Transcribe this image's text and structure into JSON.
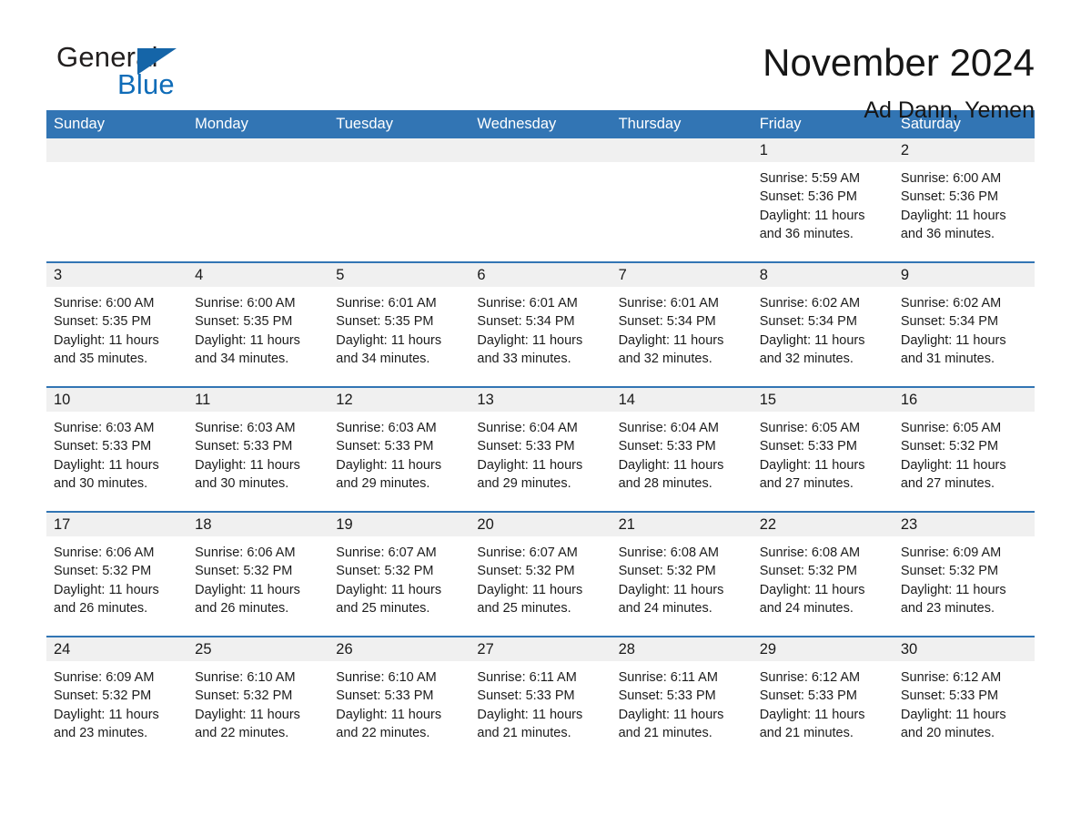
{
  "brand": {
    "word_one": "General",
    "word_two": "Blue",
    "triangle_color": "#1565a8",
    "blue_color": "#0f6cb8"
  },
  "header": {
    "title": "November 2024",
    "subtitle": "Ad Dann, Yemen"
  },
  "theme": {
    "header_bg": "#3275b4",
    "daynum_bg": "#f0f0f0",
    "rule_color": "#3275b4",
    "page_bg": "#ffffff",
    "text_color": "#1a1a1a"
  },
  "weekdays": [
    "Sunday",
    "Monday",
    "Tuesday",
    "Wednesday",
    "Thursday",
    "Friday",
    "Saturday"
  ],
  "weeks": [
    [
      {
        "empty": true
      },
      {
        "empty": true
      },
      {
        "empty": true
      },
      {
        "empty": true
      },
      {
        "empty": true
      },
      {
        "day": "1",
        "sunrise": "Sunrise: 5:59 AM",
        "sunset": "Sunset: 5:36 PM",
        "daylight_1": "Daylight: 11 hours",
        "daylight_2": "and 36 minutes."
      },
      {
        "day": "2",
        "sunrise": "Sunrise: 6:00 AM",
        "sunset": "Sunset: 5:36 PM",
        "daylight_1": "Daylight: 11 hours",
        "daylight_2": "and 36 minutes."
      }
    ],
    [
      {
        "day": "3",
        "sunrise": "Sunrise: 6:00 AM",
        "sunset": "Sunset: 5:35 PM",
        "daylight_1": "Daylight: 11 hours",
        "daylight_2": "and 35 minutes."
      },
      {
        "day": "4",
        "sunrise": "Sunrise: 6:00 AM",
        "sunset": "Sunset: 5:35 PM",
        "daylight_1": "Daylight: 11 hours",
        "daylight_2": "and 34 minutes."
      },
      {
        "day": "5",
        "sunrise": "Sunrise: 6:01 AM",
        "sunset": "Sunset: 5:35 PM",
        "daylight_1": "Daylight: 11 hours",
        "daylight_2": "and 34 minutes."
      },
      {
        "day": "6",
        "sunrise": "Sunrise: 6:01 AM",
        "sunset": "Sunset: 5:34 PM",
        "daylight_1": "Daylight: 11 hours",
        "daylight_2": "and 33 minutes."
      },
      {
        "day": "7",
        "sunrise": "Sunrise: 6:01 AM",
        "sunset": "Sunset: 5:34 PM",
        "daylight_1": "Daylight: 11 hours",
        "daylight_2": "and 32 minutes."
      },
      {
        "day": "8",
        "sunrise": "Sunrise: 6:02 AM",
        "sunset": "Sunset: 5:34 PM",
        "daylight_1": "Daylight: 11 hours",
        "daylight_2": "and 32 minutes."
      },
      {
        "day": "9",
        "sunrise": "Sunrise: 6:02 AM",
        "sunset": "Sunset: 5:34 PM",
        "daylight_1": "Daylight: 11 hours",
        "daylight_2": "and 31 minutes."
      }
    ],
    [
      {
        "day": "10",
        "sunrise": "Sunrise: 6:03 AM",
        "sunset": "Sunset: 5:33 PM",
        "daylight_1": "Daylight: 11 hours",
        "daylight_2": "and 30 minutes."
      },
      {
        "day": "11",
        "sunrise": "Sunrise: 6:03 AM",
        "sunset": "Sunset: 5:33 PM",
        "daylight_1": "Daylight: 11 hours",
        "daylight_2": "and 30 minutes."
      },
      {
        "day": "12",
        "sunrise": "Sunrise: 6:03 AM",
        "sunset": "Sunset: 5:33 PM",
        "daylight_1": "Daylight: 11 hours",
        "daylight_2": "and 29 minutes."
      },
      {
        "day": "13",
        "sunrise": "Sunrise: 6:04 AM",
        "sunset": "Sunset: 5:33 PM",
        "daylight_1": "Daylight: 11 hours",
        "daylight_2": "and 29 minutes."
      },
      {
        "day": "14",
        "sunrise": "Sunrise: 6:04 AM",
        "sunset": "Sunset: 5:33 PM",
        "daylight_1": "Daylight: 11 hours",
        "daylight_2": "and 28 minutes."
      },
      {
        "day": "15",
        "sunrise": "Sunrise: 6:05 AM",
        "sunset": "Sunset: 5:33 PM",
        "daylight_1": "Daylight: 11 hours",
        "daylight_2": "and 27 minutes."
      },
      {
        "day": "16",
        "sunrise": "Sunrise: 6:05 AM",
        "sunset": "Sunset: 5:32 PM",
        "daylight_1": "Daylight: 11 hours",
        "daylight_2": "and 27 minutes."
      }
    ],
    [
      {
        "day": "17",
        "sunrise": "Sunrise: 6:06 AM",
        "sunset": "Sunset: 5:32 PM",
        "daylight_1": "Daylight: 11 hours",
        "daylight_2": "and 26 minutes."
      },
      {
        "day": "18",
        "sunrise": "Sunrise: 6:06 AM",
        "sunset": "Sunset: 5:32 PM",
        "daylight_1": "Daylight: 11 hours",
        "daylight_2": "and 26 minutes."
      },
      {
        "day": "19",
        "sunrise": "Sunrise: 6:07 AM",
        "sunset": "Sunset: 5:32 PM",
        "daylight_1": "Daylight: 11 hours",
        "daylight_2": "and 25 minutes."
      },
      {
        "day": "20",
        "sunrise": "Sunrise: 6:07 AM",
        "sunset": "Sunset: 5:32 PM",
        "daylight_1": "Daylight: 11 hours",
        "daylight_2": "and 25 minutes."
      },
      {
        "day": "21",
        "sunrise": "Sunrise: 6:08 AM",
        "sunset": "Sunset: 5:32 PM",
        "daylight_1": "Daylight: 11 hours",
        "daylight_2": "and 24 minutes."
      },
      {
        "day": "22",
        "sunrise": "Sunrise: 6:08 AM",
        "sunset": "Sunset: 5:32 PM",
        "daylight_1": "Daylight: 11 hours",
        "daylight_2": "and 24 minutes."
      },
      {
        "day": "23",
        "sunrise": "Sunrise: 6:09 AM",
        "sunset": "Sunset: 5:32 PM",
        "daylight_1": "Daylight: 11 hours",
        "daylight_2": "and 23 minutes."
      }
    ],
    [
      {
        "day": "24",
        "sunrise": "Sunrise: 6:09 AM",
        "sunset": "Sunset: 5:32 PM",
        "daylight_1": "Daylight: 11 hours",
        "daylight_2": "and 23 minutes."
      },
      {
        "day": "25",
        "sunrise": "Sunrise: 6:10 AM",
        "sunset": "Sunset: 5:32 PM",
        "daylight_1": "Daylight: 11 hours",
        "daylight_2": "and 22 minutes."
      },
      {
        "day": "26",
        "sunrise": "Sunrise: 6:10 AM",
        "sunset": "Sunset: 5:33 PM",
        "daylight_1": "Daylight: 11 hours",
        "daylight_2": "and 22 minutes."
      },
      {
        "day": "27",
        "sunrise": "Sunrise: 6:11 AM",
        "sunset": "Sunset: 5:33 PM",
        "daylight_1": "Daylight: 11 hours",
        "daylight_2": "and 21 minutes."
      },
      {
        "day": "28",
        "sunrise": "Sunrise: 6:11 AM",
        "sunset": "Sunset: 5:33 PM",
        "daylight_1": "Daylight: 11 hours",
        "daylight_2": "and 21 minutes."
      },
      {
        "day": "29",
        "sunrise": "Sunrise: 6:12 AM",
        "sunset": "Sunset: 5:33 PM",
        "daylight_1": "Daylight: 11 hours",
        "daylight_2": "and 21 minutes."
      },
      {
        "day": "30",
        "sunrise": "Sunrise: 6:12 AM",
        "sunset": "Sunset: 5:33 PM",
        "daylight_1": "Daylight: 11 hours",
        "daylight_2": "and 20 minutes."
      }
    ]
  ]
}
